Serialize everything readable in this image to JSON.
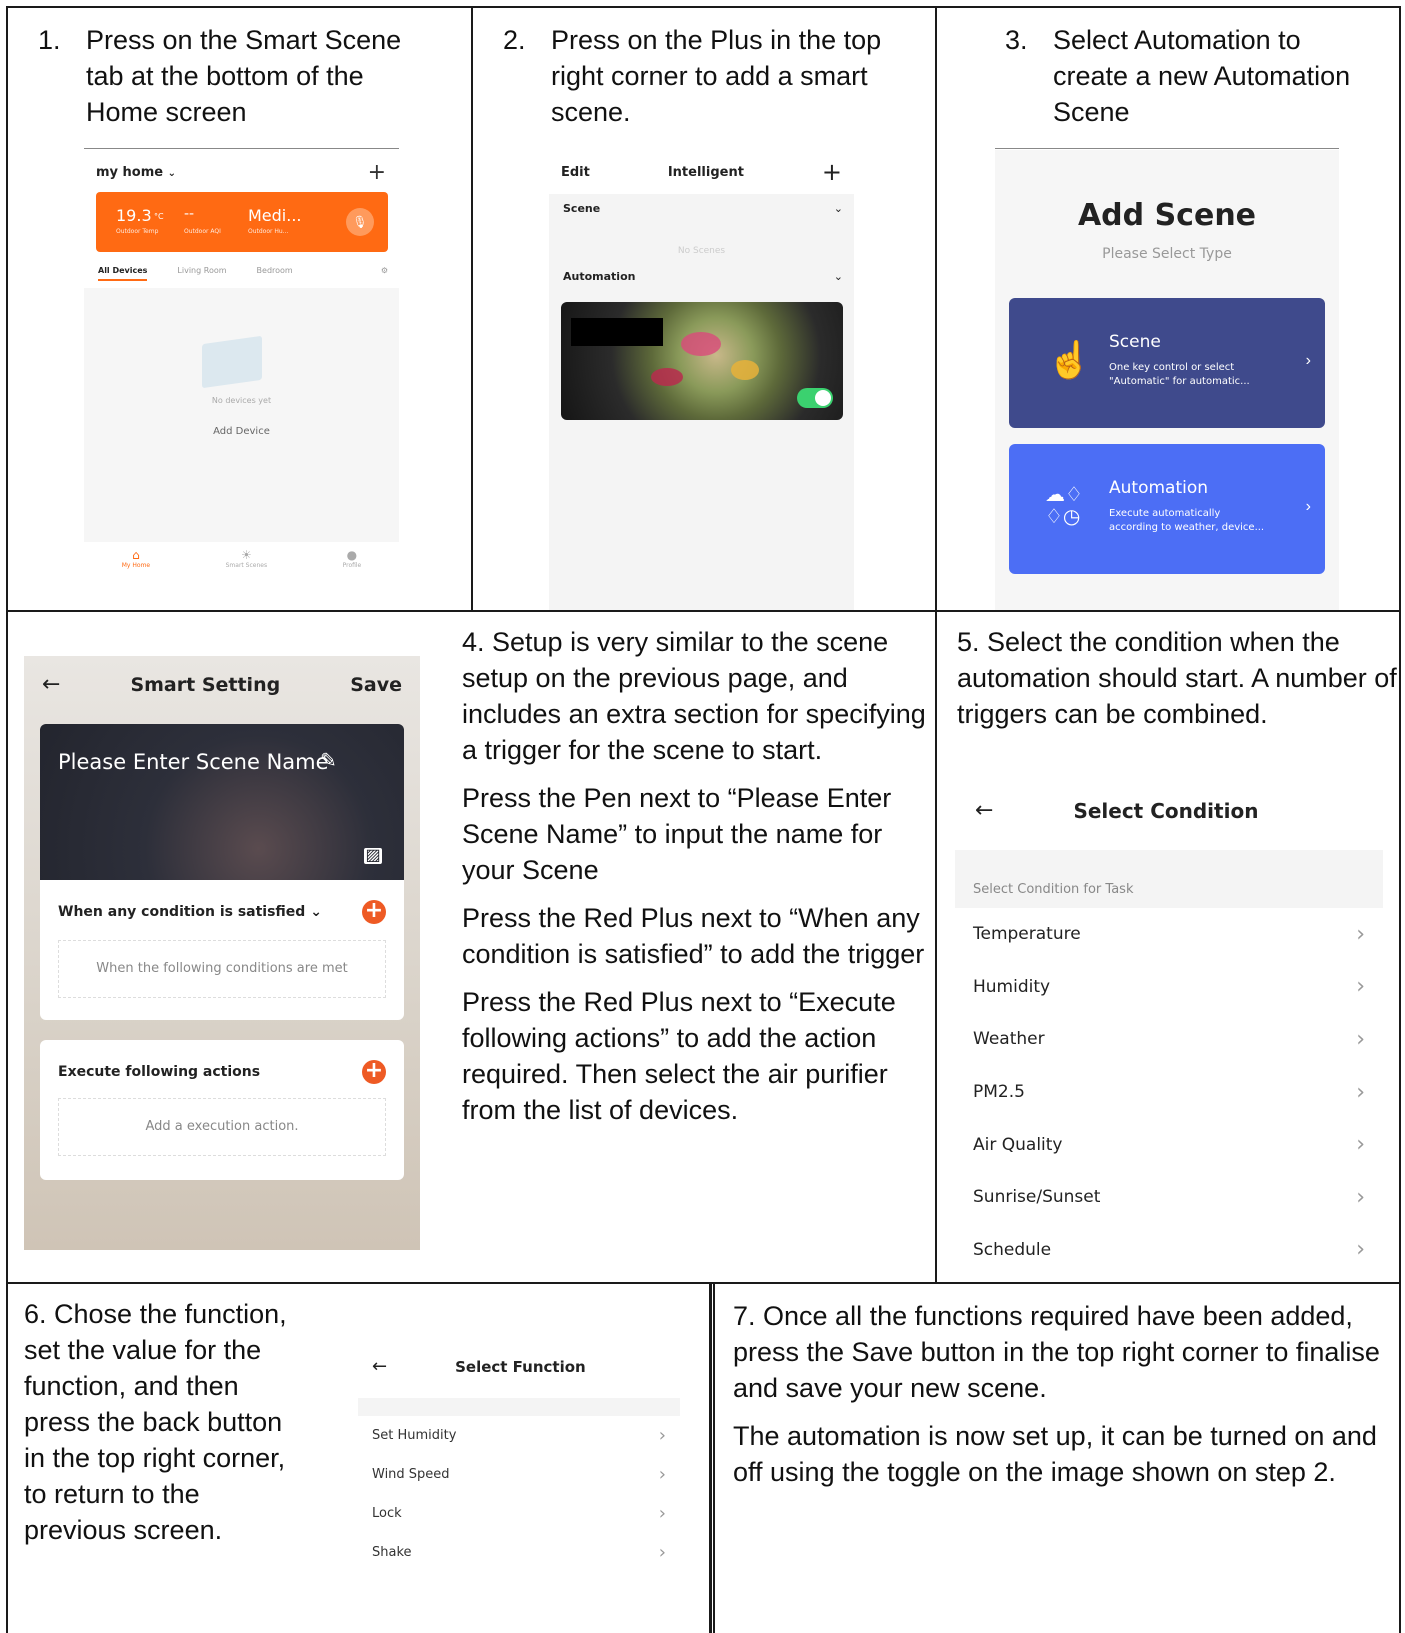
{
  "step1": {
    "num": "1.",
    "text_lines": [
      "Press on the Smart Scene",
      "tab at the bottom of the",
      "Home screen"
    ],
    "phone": {
      "home_title": "my home",
      "temp": "19.3",
      "temp_unit": "°C",
      "dash": "--",
      "medi": "Medi...",
      "temp_label": "Outdoor Temp",
      "adi_label": "Outdoor AQI",
      "hu_label": "Outdoor Hu...",
      "tabs": [
        "All Devices",
        "Living Room",
        "Bedroom"
      ],
      "no_devices": "No devices yet",
      "add_device": "Add Device",
      "nav": [
        "My Home",
        "Smart Scenes",
        "Profile"
      ],
      "accent": "#ff6a13"
    }
  },
  "step2": {
    "num": "2.",
    "text_lines": [
      "Press on the Plus in the top",
      "right corner to add a smart",
      "scene."
    ],
    "phone": {
      "edit": "Edit",
      "title": "Intelligent",
      "scene": "Scene",
      "no_scenes": "No Scenes",
      "automation": "Automation"
    }
  },
  "step3": {
    "num": "3.",
    "text_lines": [
      "Select Automation to",
      "create a new Automation",
      "Scene"
    ],
    "phone": {
      "title": "Add Scene",
      "subtitle": "Please Select Type",
      "scene_card": {
        "title": "Scene",
        "desc1": "One key control or select",
        "desc2": "\"Automatic\" for automatic...",
        "color": "#3f4a8c"
      },
      "auto_card": {
        "title": "Automation",
        "desc1": "Execute automatically",
        "desc2": "according to weather, device...",
        "color": "#4c6ef5"
      }
    }
  },
  "step4": {
    "paragraphs": [
      "4. Setup is very similar to the scene setup on the previous page, and includes an extra section for specifying a trigger for the scene to start.",
      "Press the Pen next to “Please Enter Scene Name” to input the name for your Scene",
      "Press the Red Plus next to “When any condition is satisfied” to add the trigger",
      "Press the Red Plus next to “Execute following actions” to add the action required.  Then select the air purifier from the list of devices."
    ],
    "phone": {
      "title": "Smart Setting",
      "save": "Save",
      "name_placeholder": "Please Enter Scene Name",
      "cond_title": "When any condition is satisfied",
      "cond_hint": "When the following conditions are met",
      "exec_title": "Execute following actions",
      "exec_hint": "Add a execution action."
    }
  },
  "step5": {
    "text": "5. Select the condition when the automation should start.  A number of triggers can be combined.",
    "phone": {
      "title": "Select Condition",
      "section": "Select Condition for Task",
      "items": [
        "Temperature",
        "Humidity",
        "Weather",
        "PM2.5",
        "Air Quality",
        "Sunrise/Sunset",
        "Schedule"
      ]
    }
  },
  "step6": {
    "text_lines": [
      "6. Chose the function,",
      "set the value for the",
      "function, and then",
      "press the back button",
      "in the top right corner,",
      "to return to the",
      "previous screen."
    ],
    "phone": {
      "title": "Select Function",
      "items": [
        "Set Humidity",
        "Wind Speed",
        "Lock",
        "Shake"
      ]
    }
  },
  "step7": {
    "paragraphs": [
      "7. Once all the functions required have been added, press the Save button in the top right corner to finalise and save your new scene.",
      "The automation is now set up, it can be turned on and off using the toggle on the image shown on step 2."
    ]
  }
}
